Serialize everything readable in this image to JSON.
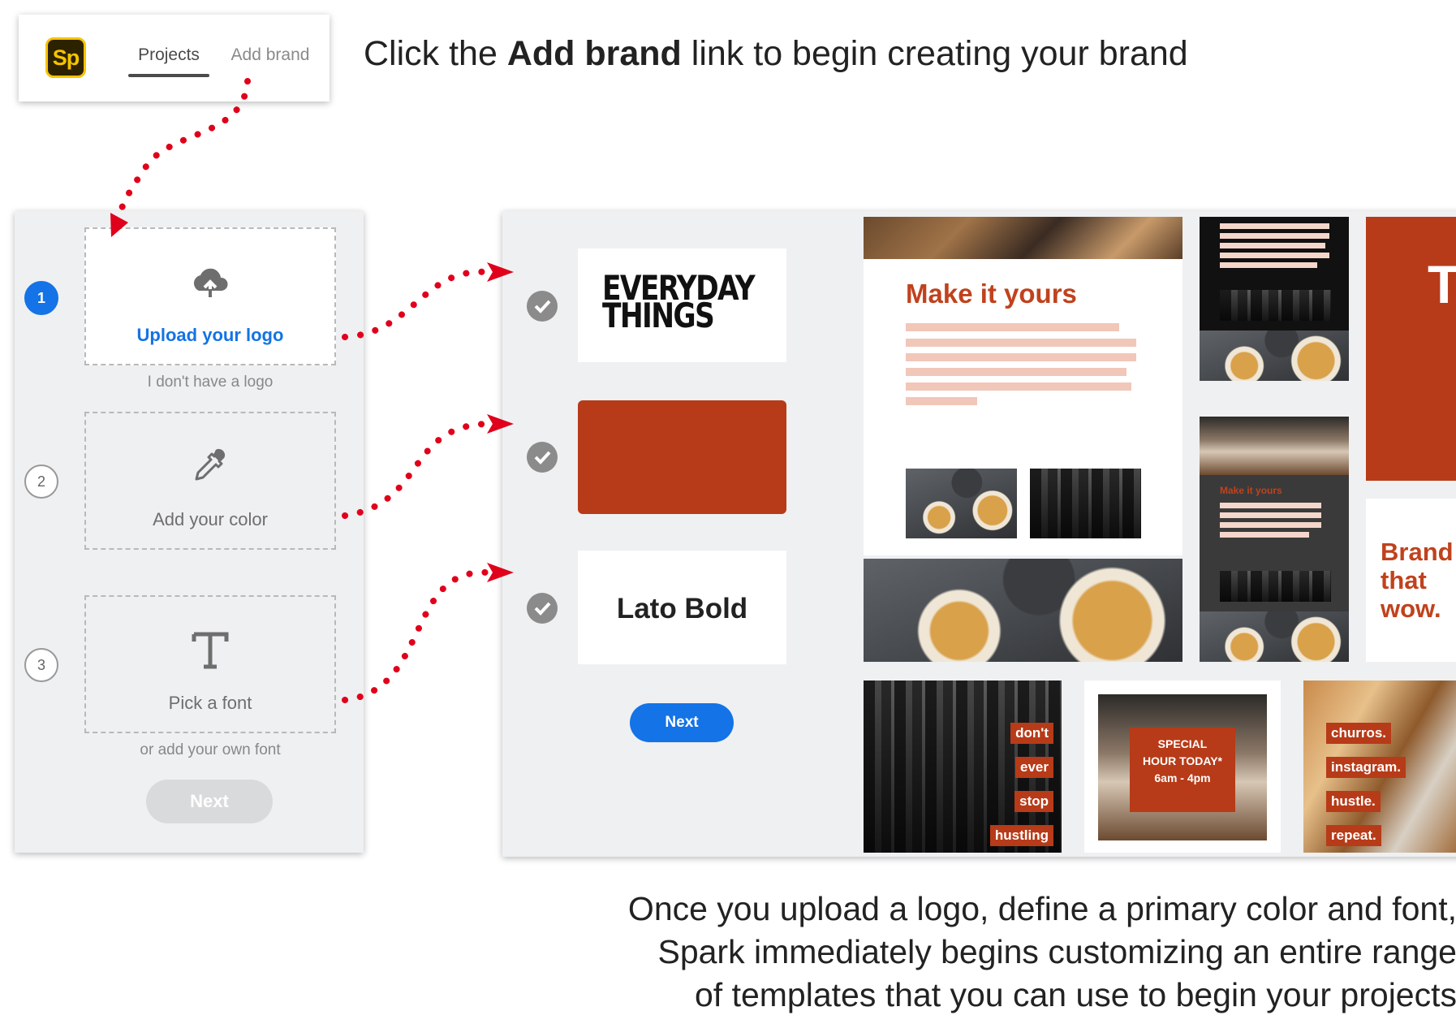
{
  "header": {
    "app_logo_text": "Sp",
    "nav": {
      "projects": "Projects",
      "add_brand": "Add brand"
    }
  },
  "caption_top": {
    "pre": "Click the ",
    "bold": "Add brand",
    "post": " link to begin creating your brand"
  },
  "wizard": {
    "steps": [
      {
        "number": "1",
        "label": "Upload your logo",
        "icon": "cloud-upload-icon",
        "sub": "I don't have a logo"
      },
      {
        "number": "2",
        "label": "Add your color",
        "icon": "eyedropper-icon"
      },
      {
        "number": "3",
        "label": "Pick a font",
        "icon": "text-type-icon",
        "sub": "or add your own font"
      }
    ],
    "next": "Next"
  },
  "brand": {
    "logo_line1": "EVERYDAY",
    "logo_line2": "THINGS",
    "color": "#b73b18",
    "font": "Lato Bold",
    "next": "Next"
  },
  "templates": {
    "make_it_yours": "Make it yours",
    "make_it_yours_small": "Make it yours",
    "big_letter": "T",
    "brand_tagline": [
      "Brand",
      "that",
      "wow."
    ],
    "city_tags": [
      "don't",
      "ever",
      "stop",
      "hustling"
    ],
    "special": [
      "SPECIAL",
      "HOUR TODAY*",
      "6am - 4pm"
    ],
    "bread_tags": [
      "churros.",
      "instagram.",
      "hustle.",
      "repeat."
    ]
  },
  "caption_bottom": [
    "Once you upload a logo, define a primary color and font,",
    "Spark immediately begins customizing an entire range",
    "of templates that you can use to begin your projects"
  ],
  "colors": {
    "accent_blue": "#1473e6",
    "brand_red": "#b73b18",
    "dotted_arrow": "#e0001b"
  }
}
